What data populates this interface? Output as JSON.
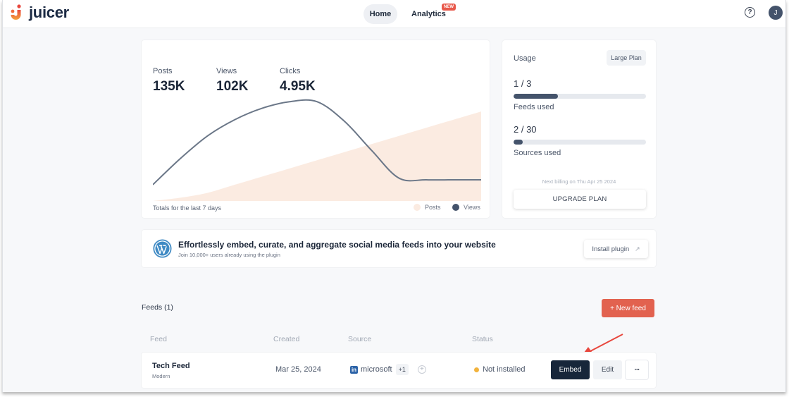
{
  "app": {
    "brand": "juicer",
    "accent_color": "#e2624f",
    "nav": {
      "home_label": "Home",
      "analytics_label": "Analytics",
      "analytics_badge": "NEW"
    },
    "help_icon": "question-circle-icon",
    "help_glyph": "?",
    "avatar_initial": "J"
  },
  "stats": {
    "items": [
      {
        "label": "Posts",
        "value": "135K"
      },
      {
        "label": "Views",
        "value": "102K"
      },
      {
        "label": "Clicks",
        "value": "4.95K"
      }
    ],
    "footer": "Totals for the last 7 days",
    "legend": [
      {
        "label": "Posts",
        "color": "#fbebe1"
      },
      {
        "label": "Views",
        "color": "#44536b"
      }
    ]
  },
  "chart_data": {
    "type": "area",
    "title": "",
    "xlabel": "",
    "ylabel": "",
    "grid": false,
    "legend_position": "bottom-right",
    "x": [
      0,
      1,
      2,
      3,
      4,
      5,
      6,
      7,
      8,
      9,
      10,
      11,
      12
    ],
    "series": [
      {
        "name": "Posts",
        "style": "area",
        "color": "#fbebe1",
        "values": [
          0,
          4,
          10,
          20,
          30,
          40,
          50,
          60,
          70,
          80,
          90,
          100,
          110
        ]
      },
      {
        "name": "Views",
        "style": "line",
        "color": "#6b7788",
        "values": [
          20,
          52,
          80,
          100,
          114,
          122,
          122,
          98,
          62,
          28,
          26,
          26,
          26
        ]
      }
    ],
    "ylim": [
      0,
      130
    ]
  },
  "usage": {
    "title": "Usage",
    "plan": "Large Plan",
    "feeds": {
      "value": "1 / 3",
      "label": "Feeds used",
      "fraction": 0.333
    },
    "sources": {
      "value": "2 / 30",
      "label": "Sources used",
      "fraction": 0.067
    },
    "billing": "Next billing on Thu Apr 25 2024",
    "upgrade_label": "UPGRADE PLAN"
  },
  "plugin": {
    "title": "Effortlessly embed, curate, and aggregate social media feeds into your website",
    "subtitle": "Join 10,000+ users already using the plugin",
    "install_label": "Install plugin",
    "install_icon_glyph": "↗"
  },
  "feeds": {
    "title": "Feeds (1)",
    "new_feed_label": "+ New feed",
    "columns": [
      "Feed",
      "Created",
      "Source",
      "Status"
    ],
    "rows": [
      {
        "name": "Tech Feed",
        "style": "Modern",
        "created": "Mar 25, 2024",
        "source_network_glyph": "in",
        "source_name": "microsoft",
        "source_extra": "+1",
        "add_source_glyph": "+",
        "status": "Not installed",
        "status_color": "#f2b33d",
        "embed_label": "Embed",
        "edit_label": "Edit",
        "more_label": "···"
      }
    ]
  }
}
